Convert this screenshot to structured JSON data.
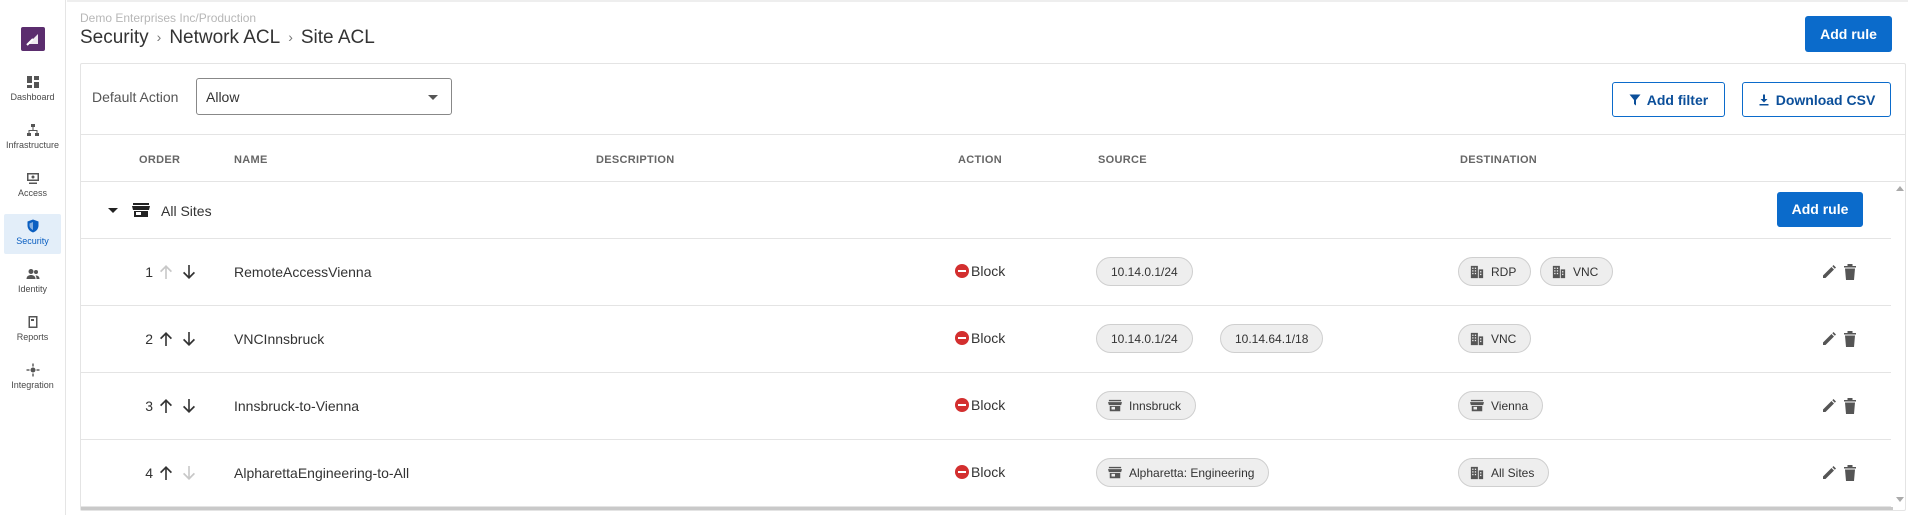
{
  "colors": {
    "primary": "#0b6bcb",
    "block": "#d32f2f",
    "active_nav_bg": "#e3eef9",
    "logo": "#5b2d6e"
  },
  "sidebar": {
    "items": [
      {
        "label": "Dashboard",
        "icon": "dashboard-icon"
      },
      {
        "label": "Infrastructure",
        "icon": "infrastructure-icon"
      },
      {
        "label": "Access",
        "icon": "access-icon"
      },
      {
        "label": "Security",
        "icon": "shield-icon",
        "active": true
      },
      {
        "label": "Identity",
        "icon": "identity-icon"
      },
      {
        "label": "Reports",
        "icon": "reports-icon"
      },
      {
        "label": "Integration",
        "icon": "integration-icon"
      }
    ]
  },
  "header": {
    "org": "Demo Enterprises Inc/Production",
    "breadcrumb": [
      "Security",
      "Network ACL",
      "Site ACL"
    ],
    "add_rule_label": "Add rule"
  },
  "toolbar": {
    "default_action_label": "Default Action",
    "default_action_value": "Allow",
    "add_filter_label": "Add filter",
    "download_csv_label": "Download CSV"
  },
  "table": {
    "columns": [
      "ORDER",
      "NAME",
      "DESCRIPTION",
      "ACTION",
      "SOURCE",
      "DESTINATION"
    ],
    "group": {
      "label": "All Sites",
      "add_rule_label": "Add rule"
    },
    "rows": [
      {
        "order": "1",
        "name": "RemoteAccessVienna",
        "action": "Block",
        "up_enabled": false,
        "down_enabled": true,
        "source": [
          {
            "label": "10.14.0.1/24",
            "icon": ""
          }
        ],
        "destination": [
          {
            "label": "RDP",
            "icon": "building-icon"
          },
          {
            "label": "VNC",
            "icon": "building-icon"
          }
        ]
      },
      {
        "order": "2",
        "name": "VNCInnsbruck",
        "action": "Block",
        "up_enabled": true,
        "down_enabled": true,
        "source": [
          {
            "label": "10.14.0.1/24",
            "icon": ""
          },
          {
            "label": "10.14.64.1/18",
            "icon": ""
          }
        ],
        "destination": [
          {
            "label": "VNC",
            "icon": "building-icon"
          }
        ]
      },
      {
        "order": "3",
        "name": "Innsbruck-to-Vienna",
        "action": "Block",
        "up_enabled": true,
        "down_enabled": true,
        "source": [
          {
            "label": "Innsbruck",
            "icon": "store-icon"
          }
        ],
        "destination": [
          {
            "label": "Vienna",
            "icon": "store-icon"
          }
        ]
      },
      {
        "order": "4",
        "name": "AlpharettaEngineering-to-All",
        "action": "Block",
        "up_enabled": true,
        "down_enabled": false,
        "source": [
          {
            "label": "Alpharetta: Engineering",
            "icon": "store-icon"
          }
        ],
        "destination": [
          {
            "label": "All Sites",
            "icon": "building-icon"
          }
        ]
      }
    ]
  }
}
